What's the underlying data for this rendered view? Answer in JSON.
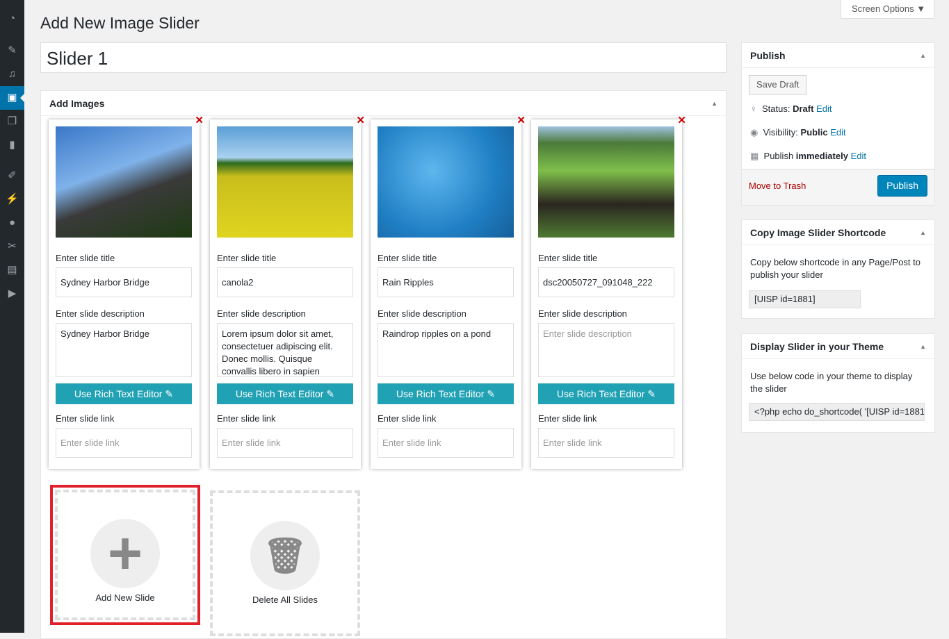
{
  "sidebar": {
    "icons": [
      "dashboard-icon",
      "pin-icon",
      "media-icon",
      "slider-icon",
      "pages-icon",
      "comments-icon",
      "appearance-icon",
      "plugins-icon",
      "users-icon",
      "tools-icon",
      "settings-icon",
      "play-icon"
    ],
    "active": 3
  },
  "screen_options": "Screen Options ▼",
  "page_title": "Add New Image Slider",
  "slider_title": "Slider 1",
  "images_box": {
    "title": "Add Images"
  },
  "labels": {
    "title": "Enter slide title",
    "desc": "Enter slide description",
    "link": "Enter slide link",
    "rich": "Use Rich Text Editor",
    "desc_ph": "Enter slide description",
    "link_ph": "Enter slide link"
  },
  "slides": [
    {
      "title": "Sydney Harbor Bridge",
      "desc": "Sydney Harbor Bridge"
    },
    {
      "title": "canola2",
      "desc": "Lorem ipsum dolor sit amet, consectetuer adipiscing elit. Donec mollis. Quisque convallis libero in sapien"
    },
    {
      "title": "Rain Ripples",
      "desc": "Raindrop ripples on a pond"
    },
    {
      "title": "dsc20050727_091048_222",
      "desc": ""
    }
  ],
  "add_new": "Add New Slide",
  "delete_all": "Delete All Slides",
  "publish": {
    "title": "Publish",
    "save_draft": "Save Draft",
    "status_label": "Status:",
    "status": "Draft",
    "visibility_label": "Visibility:",
    "visibility": "Public",
    "publish_label": "Publish",
    "publish_when": "immediately",
    "edit": "Edit",
    "trash": "Move to Trash",
    "publish_btn": "Publish"
  },
  "shortcode": {
    "title": "Copy Image Slider Shortcode",
    "text": "Copy below shortcode in any Page/Post to publish your slider",
    "value": "[UISP id=1881]"
  },
  "theme": {
    "title": "Display Slider in your Theme",
    "text": "Use below code in your theme to display the slider",
    "value": "<?php echo do_shortcode( '[UISP id=1881"
  },
  "colors": {
    "accent": "#0073aa",
    "button": "#21a2b4",
    "highlight": "#e0202a"
  }
}
